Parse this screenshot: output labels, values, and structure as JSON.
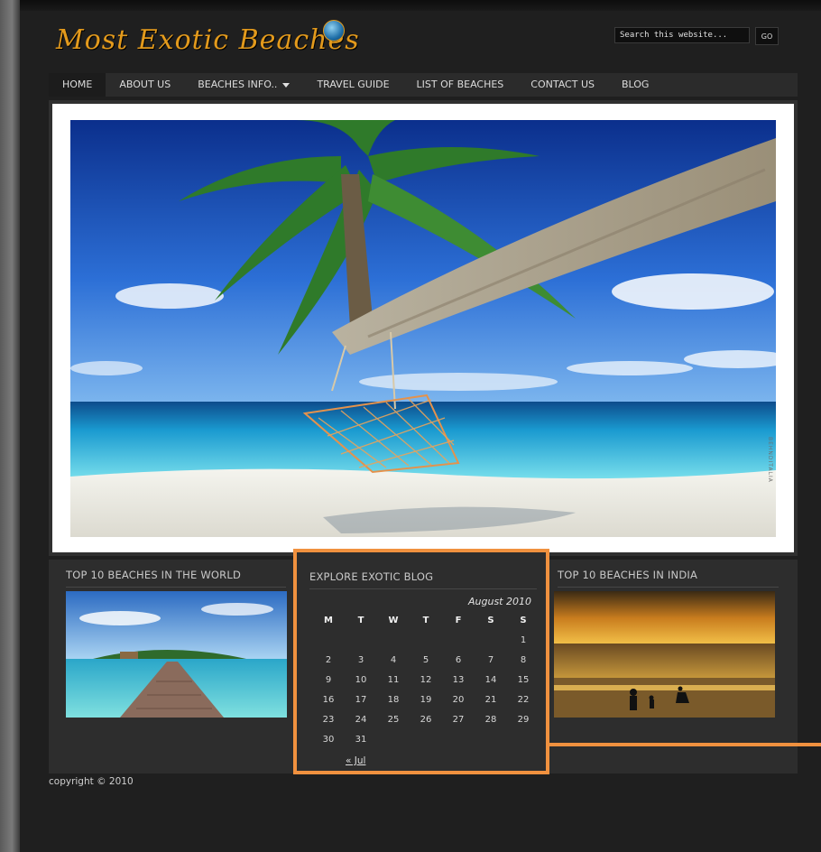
{
  "site": {
    "logo_text": "Most Exotic Beaches"
  },
  "search": {
    "placeholder": "Search this website...",
    "button_label": "GO"
  },
  "nav": {
    "home": "HOME",
    "about": "ABOUT US",
    "beaches_info": "BEACHES INFO..",
    "travel_guide": "TRAVEL GUIDE",
    "list_of_beaches": "LIST OF BEACHES",
    "contact": "CONTACT US",
    "blog": "BLOG"
  },
  "hero": {
    "watermark": "BEHNDITALIA"
  },
  "widgets": {
    "world": {
      "title": "TOP 10 BEACHES IN THE WORLD"
    },
    "calendar": {
      "title": "EXPLORE EXOTIC BLOG",
      "caption": "August 2010",
      "days": [
        "M",
        "T",
        "W",
        "T",
        "F",
        "S",
        "S"
      ],
      "weeks": [
        [
          "",
          "",
          "",
          "",
          "",
          "",
          "1"
        ],
        [
          "2",
          "3",
          "4",
          "5",
          "6",
          "7",
          "8"
        ],
        [
          "9",
          "10",
          "11",
          "12",
          "13",
          "14",
          "15"
        ],
        [
          "16",
          "17",
          "18",
          "19",
          "20",
          "21",
          "22"
        ],
        [
          "23",
          "24",
          "25",
          "26",
          "27",
          "28",
          "29"
        ],
        [
          "30",
          "31",
          "",
          "",
          "",
          "",
          ""
        ]
      ],
      "prev_link": "« Jul"
    },
    "india": {
      "title": "TOP 10 BEACHES IN INDIA"
    }
  },
  "footer": {
    "copyright": "copyright © 2010"
  },
  "colors": {
    "accent": "#e39a1c",
    "highlight": "#f0913f",
    "background": "#1f1f1f"
  }
}
